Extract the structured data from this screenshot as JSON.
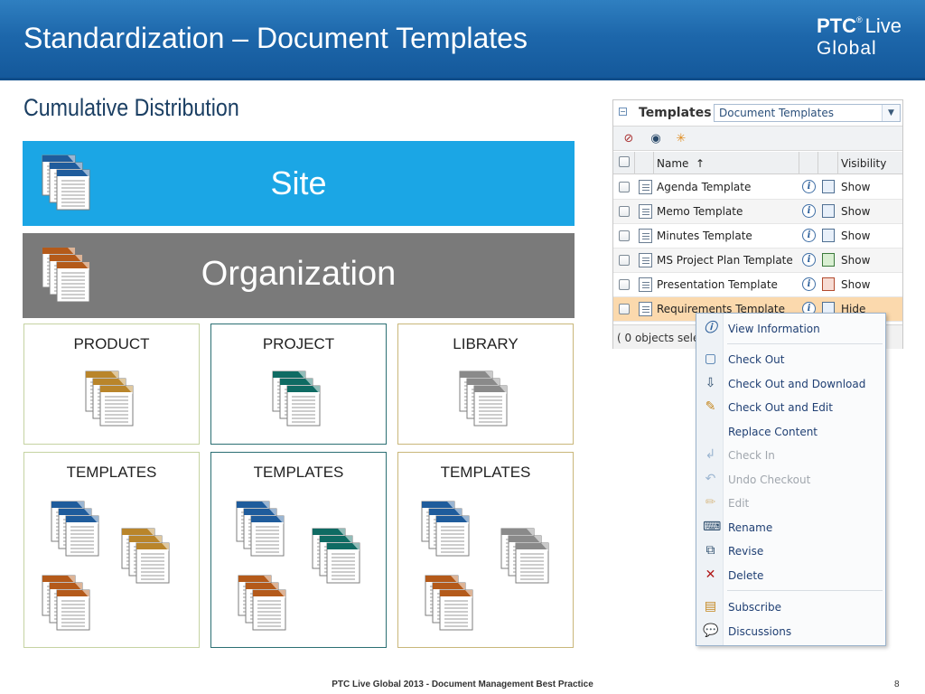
{
  "header": {
    "title": "Standardization – Document Templates",
    "logo_ptc": "PTC",
    "logo_live": "Live",
    "logo_global": "Global"
  },
  "subtitle": "Cumulative Distribution",
  "hierarchy": {
    "site": "Site",
    "organization": "Organization",
    "contexts": [
      "PRODUCT",
      "PROJECT",
      "LIBRARY"
    ],
    "templates_label": "TEMPLATES"
  },
  "colors": {
    "site_bar": "#1ba6e5",
    "org_bar": "#7a7a7a",
    "doc_blue": "#1f5c9c",
    "doc_orange": "#b45a1a",
    "doc_gold": "#b9852b",
    "doc_teal": "#0f6b63",
    "doc_gray": "#8a8a8a"
  },
  "panel": {
    "title": "Templates",
    "select_value": "Document Templates",
    "columns": {
      "name": "Name",
      "sort_indicator": "↑",
      "visibility": "Visibility"
    },
    "rows": [
      {
        "name": "Agenda Template",
        "visibility": "Show"
      },
      {
        "name": "Memo Template",
        "visibility": "Show"
      },
      {
        "name": "Minutes Template",
        "visibility": "Show"
      },
      {
        "name": "MS Project Plan Template",
        "visibility": "Show"
      },
      {
        "name": "Presentation Template",
        "visibility": "Show"
      },
      {
        "name": "Requirements Template",
        "visibility": "Hide"
      }
    ],
    "footer": "( 0 objects selec"
  },
  "context_menu": {
    "items": [
      {
        "label": "View Information",
        "icon": "info-icon",
        "disabled": false
      },
      {
        "label": "Check Out",
        "icon": "check-out-icon",
        "disabled": false
      },
      {
        "label": "Check Out and Download",
        "icon": "download-icon",
        "disabled": false
      },
      {
        "label": "Check Out and Edit",
        "icon": "edit-icon",
        "disabled": false
      },
      {
        "label": "Replace Content",
        "icon": "",
        "disabled": false
      },
      {
        "label": "Check In",
        "icon": "check-in-icon",
        "disabled": true
      },
      {
        "label": "Undo Checkout",
        "icon": "undo-icon",
        "disabled": true
      },
      {
        "label": "Edit",
        "icon": "pencil-icon",
        "disabled": true
      },
      {
        "label": "Rename",
        "icon": "rename-icon",
        "disabled": false
      },
      {
        "label": "Revise",
        "icon": "revise-icon",
        "disabled": false
      },
      {
        "label": "Delete",
        "icon": "delete-icon",
        "disabled": false
      },
      {
        "label": "Subscribe",
        "icon": "subscribe-icon",
        "disabled": false
      },
      {
        "label": "Discussions",
        "icon": "discussions-icon",
        "disabled": false
      }
    ]
  },
  "footer": {
    "text": "PTC Live Global 2013 - Document Management Best Practice",
    "page_number": "8"
  }
}
